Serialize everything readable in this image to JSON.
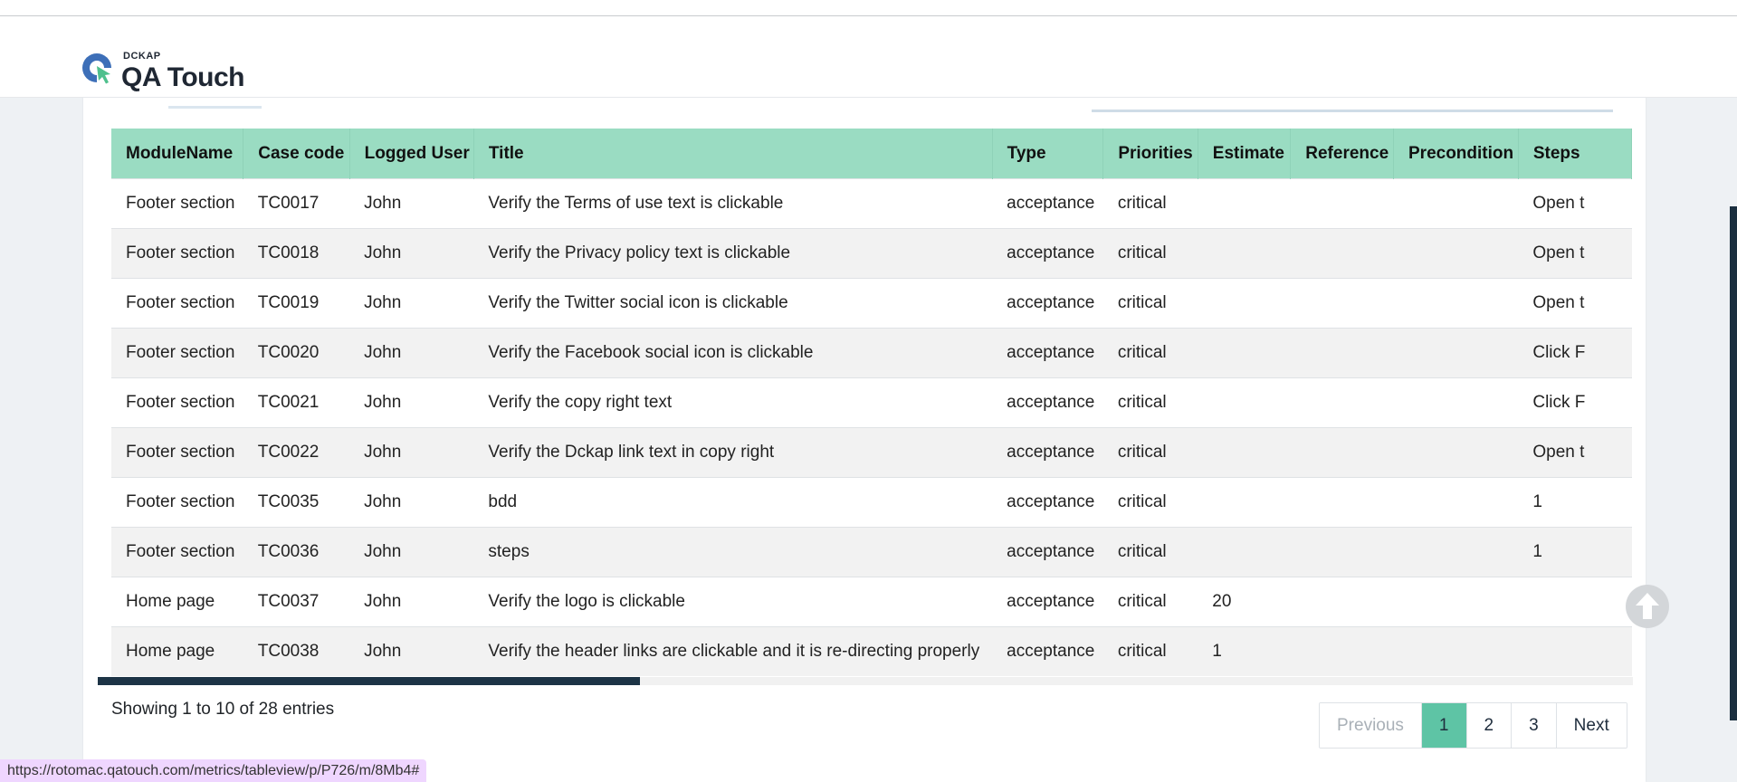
{
  "brand": {
    "small": "DCKAP",
    "name": "QA Touch",
    "accent": "#9adcc2"
  },
  "table": {
    "columns": [
      "ModuleName",
      "Case code",
      "Logged User",
      "Title",
      "Type",
      "Priorities",
      "Estimate",
      "Reference",
      "Precondition",
      "Steps"
    ],
    "rows": [
      [
        "Footer section",
        "TC0017",
        "John",
        "Verify the Terms of use text is clickable",
        "acceptance",
        "critical",
        "",
        "",
        "",
        "Open t"
      ],
      [
        "Footer section",
        "TC0018",
        "John",
        "Verify the Privacy policy text is clickable",
        "acceptance",
        "critical",
        "",
        "",
        "",
        "Open t"
      ],
      [
        "Footer section",
        "TC0019",
        "John",
        "Verify the Twitter social icon is clickable",
        "acceptance",
        "critical",
        "",
        "",
        "",
        "Open t"
      ],
      [
        "Footer section",
        "TC0020",
        "John",
        "Verify the Facebook social icon is clickable",
        "acceptance",
        "critical",
        "",
        "",
        "",
        "Click F"
      ],
      [
        "Footer section",
        "TC0021",
        "John",
        "Verify the copy right text",
        "acceptance",
        "critical",
        "",
        "",
        "",
        "Click F"
      ],
      [
        "Footer section",
        "TC0022",
        "John",
        "Verify the Dckap link text in copy right",
        "acceptance",
        "critical",
        "",
        "",
        "",
        "Open t"
      ],
      [
        "Footer section",
        "TC0035",
        "John",
        "bdd",
        "acceptance",
        "critical",
        "",
        "",
        "",
        "1"
      ],
      [
        "Footer section",
        "TC0036",
        "John",
        "steps",
        "acceptance",
        "critical",
        "",
        "",
        "",
        "1"
      ],
      [
        "Home page",
        "TC0037",
        "John",
        "Verify the logo is clickable",
        "acceptance",
        "critical",
        "20",
        "",
        "",
        ""
      ],
      [
        "Home page",
        "TC0038",
        "John",
        "Verify the header links are clickable and it is re-directing properly",
        "acceptance",
        "critical",
        "1",
        "",
        "",
        ""
      ]
    ]
  },
  "info": "Showing 1 to 10 of 28 entries",
  "pagination": {
    "previous": "Previous",
    "pages": [
      "1",
      "2",
      "3"
    ],
    "active": "1",
    "next": "Next"
  },
  "status_bar": {
    "url": "https://rotomac.qatouch.com/metrics/tableview/p/P726/m/8Mb4#"
  }
}
